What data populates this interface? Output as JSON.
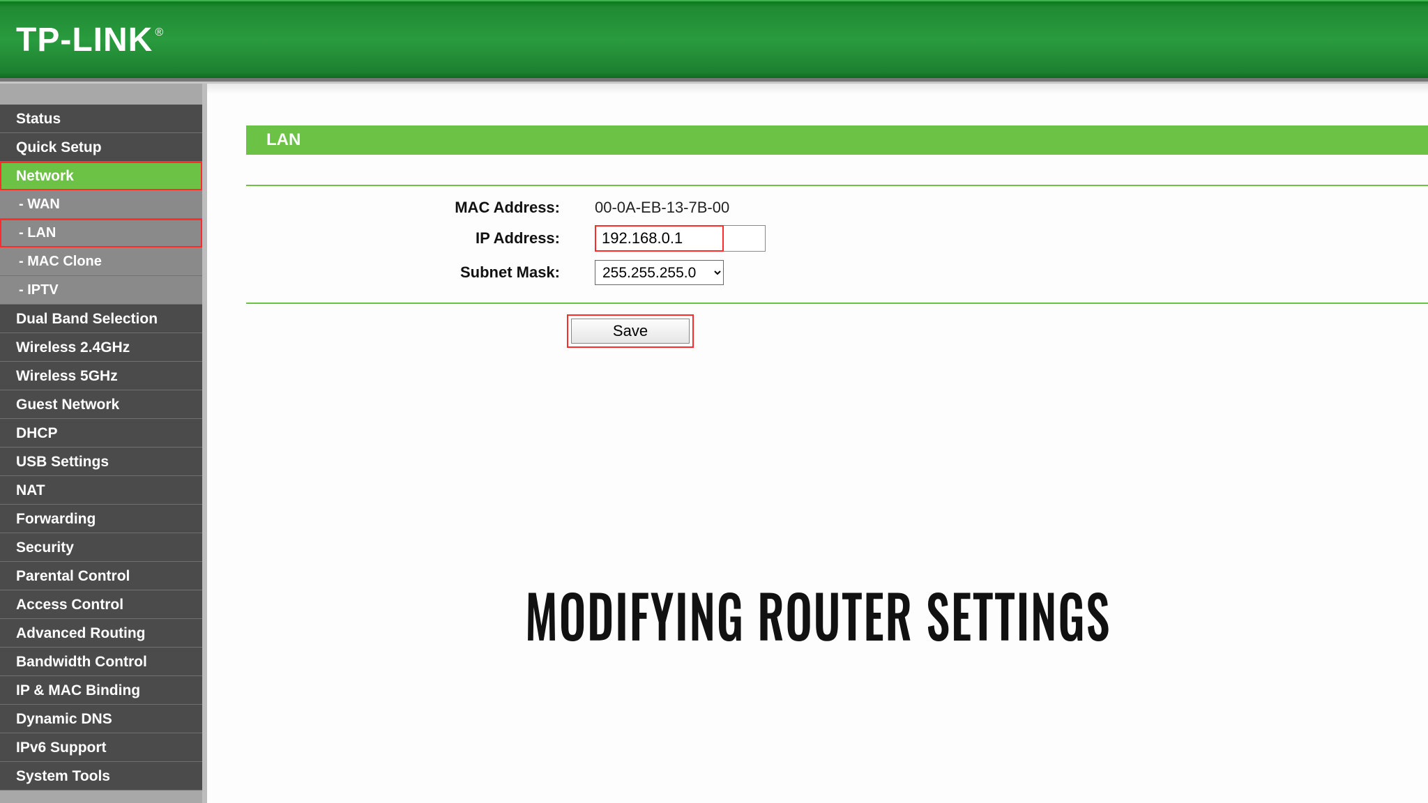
{
  "brand": "TP-LINK",
  "sidebar": {
    "items": [
      {
        "label": "Status",
        "type": "top",
        "active": false,
        "highlight": false
      },
      {
        "label": "Quick Setup",
        "type": "top",
        "active": false,
        "highlight": false
      },
      {
        "label": "Network",
        "type": "top",
        "active": true,
        "highlight": true
      },
      {
        "label": "- WAN",
        "type": "sub",
        "active": false,
        "highlight": false
      },
      {
        "label": "- LAN",
        "type": "sub",
        "active": false,
        "highlight": true
      },
      {
        "label": "- MAC Clone",
        "type": "sub",
        "active": false,
        "highlight": false
      },
      {
        "label": "- IPTV",
        "type": "sub",
        "active": false,
        "highlight": false
      },
      {
        "label": "Dual Band Selection",
        "type": "top",
        "active": false,
        "highlight": false
      },
      {
        "label": "Wireless 2.4GHz",
        "type": "top",
        "active": false,
        "highlight": false
      },
      {
        "label": "Wireless 5GHz",
        "type": "top",
        "active": false,
        "highlight": false
      },
      {
        "label": "Guest Network",
        "type": "top",
        "active": false,
        "highlight": false
      },
      {
        "label": "DHCP",
        "type": "top",
        "active": false,
        "highlight": false
      },
      {
        "label": "USB Settings",
        "type": "top",
        "active": false,
        "highlight": false
      },
      {
        "label": "NAT",
        "type": "top",
        "active": false,
        "highlight": false
      },
      {
        "label": "Forwarding",
        "type": "top",
        "active": false,
        "highlight": false
      },
      {
        "label": "Security",
        "type": "top",
        "active": false,
        "highlight": false
      },
      {
        "label": "Parental Control",
        "type": "top",
        "active": false,
        "highlight": false
      },
      {
        "label": "Access Control",
        "type": "top",
        "active": false,
        "highlight": false
      },
      {
        "label": "Advanced Routing",
        "type": "top",
        "active": false,
        "highlight": false
      },
      {
        "label": "Bandwidth Control",
        "type": "top",
        "active": false,
        "highlight": false
      },
      {
        "label": "IP & MAC Binding",
        "type": "top",
        "active": false,
        "highlight": false
      },
      {
        "label": "Dynamic DNS",
        "type": "top",
        "active": false,
        "highlight": false
      },
      {
        "label": "IPv6 Support",
        "type": "top",
        "active": false,
        "highlight": false
      },
      {
        "label": "System Tools",
        "type": "top",
        "active": false,
        "highlight": false
      }
    ]
  },
  "panel": {
    "title": "LAN",
    "mac_label": "MAC Address:",
    "mac_value": "00-0A-EB-13-7B-00",
    "ip_label": "IP Address:",
    "ip_value": "192.168.0.1",
    "subnet_label": "Subnet Mask:",
    "subnet_value": "255.255.255.0",
    "save_label": "Save"
  },
  "overlay_caption": "MODIFYING ROUTER SETTINGS"
}
